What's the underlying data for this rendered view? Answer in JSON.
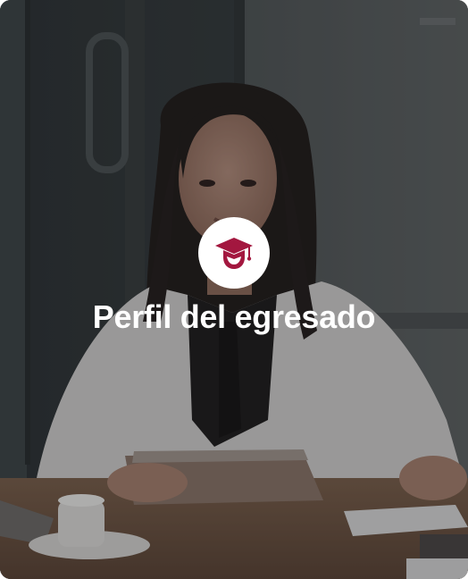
{
  "card": {
    "title": "Perfil del egresado",
    "icon": "graduation-cap-icon",
    "image": "woman-office-tablet-photo"
  },
  "colors": {
    "accent": "#a3173f",
    "title_text": "#ffffff",
    "badge_bg": "#ffffff"
  }
}
